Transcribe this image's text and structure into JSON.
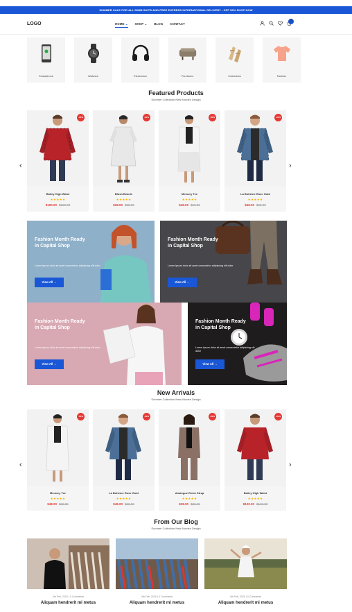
{
  "topbar": {
    "text": "SUMMER SALE FOR ALL SWIM SUITS AND FREE EXPRESS INTERNATIONAL DELIVERY - OFF 50% SHOP NOW"
  },
  "header": {
    "logo": "LOGO",
    "nav": [
      "HOME",
      "SHOP",
      "BLOG",
      "CONTACT"
    ],
    "active_nav": "HOME",
    "cart_count": "0",
    "icons": [
      "user-icon",
      "search-icon",
      "heart-icon",
      "cart-icon"
    ]
  },
  "categories": [
    {
      "label": "Smartphone",
      "icon": "smartphone-icon"
    },
    {
      "label": "Watches",
      "icon": "watch-icon"
    },
    {
      "label": "Electronics",
      "icon": "headphones-icon"
    },
    {
      "label": "Furnitures",
      "icon": "ottoman-icon"
    },
    {
      "label": "Collections",
      "icon": "sandals-icon"
    },
    {
      "label": "Fashion",
      "icon": "tshirt-icon"
    }
  ],
  "featured": {
    "title": "Featured Products",
    "subtitle": "Summer Collection New Morden Design",
    "products": [
      {
        "name": "Bailey High Waist",
        "badge": "-20%",
        "price": "$100.00",
        "old": "$120.00",
        "stars": "★★★★★"
      },
      {
        "name": "Blush Beanie",
        "badge": "-20%",
        "price": "$28.00",
        "old": "$35.00",
        "stars": "★★★★★"
      },
      {
        "name": "Memory Tee",
        "badge": "-20%",
        "price": "$48.00",
        "old": "$60.00",
        "stars": "★★★★★"
      },
      {
        "name": "La Bohème Rose Gold",
        "badge": "-20%",
        "price": "$48.00",
        "old": "$60.00",
        "stars": "★★★★★"
      }
    ]
  },
  "banners": [
    {
      "title": "Fashion Month Ready in Capital Shop",
      "desc": "Lorem ipsum dolor sit amet consectetur adipiscing elit dolor",
      "button": "View All →"
    },
    {
      "title": "Fashion Month Ready in Capital Shop",
      "desc": "Lorem ipsum dolor sit amet consectetur adipiscing elit dolor",
      "button": "View All →"
    },
    {
      "title": "Fashion Month Ready in Capital Shop",
      "desc": "Lorem ipsum dolor sit amet consectetur adipiscing elit dolor",
      "button": "View All →"
    },
    {
      "title": "Fashion Month Ready in Capital Shop",
      "desc": "Lorem ipsum dolor sit amet consectetur adipiscing elit dolor",
      "button": "View All →"
    }
  ],
  "arrivals": {
    "title": "New Arrivals",
    "subtitle": "Summer Collection New Morden Design",
    "products": [
      {
        "name": "Memory Tee",
        "badge": "-20%",
        "price": "$48.00",
        "old": "$60.00",
        "stars": "★★★★★"
      },
      {
        "name": "La Bohème Rose Gold",
        "badge": "-20%",
        "price": "$48.00",
        "old": "$60.00",
        "stars": "★★★★★"
      },
      {
        "name": "Analogue Resin Strap",
        "badge": "-20%",
        "price": "$28.00",
        "old": "$35.00",
        "stars": "★★★★★"
      },
      {
        "name": "Bailey High Waist",
        "badge": "-20%",
        "price": "$100.00",
        "old": "$120.00",
        "stars": "★★★★★"
      }
    ]
  },
  "blog": {
    "title": "From Our Blog",
    "subtitle": "Summer Collection New Morden Design",
    "posts": [
      {
        "meta": "4th Feb, 2020 | 0 Comments",
        "title": "Aliquam hendrerit mi metus"
      },
      {
        "meta": "4th Feb, 2020 | 0 Comments",
        "title": "Aliquam hendrerit mi metus"
      },
      {
        "meta": "4th Feb, 2020 | 0 Comments",
        "title": "Aliquam hendrerit mi metus"
      }
    ]
  },
  "colors": {
    "accent": "#1a57d6",
    "sale": "#e53935",
    "star": "#f5b301"
  }
}
